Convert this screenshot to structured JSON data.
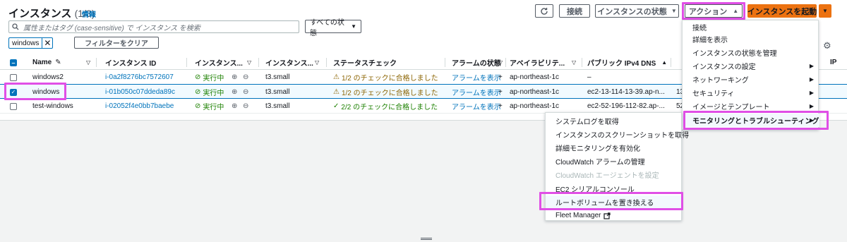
{
  "header": {
    "title": "インスタンス",
    "count": "(1/3)",
    "info": "情報"
  },
  "toolbar": {
    "refresh_icon": "refresh-icon",
    "connect_label": "接続",
    "instance_state_label": "インスタンスの状態",
    "actions_label": "アクション",
    "launch_label": "インスタンスを起動"
  },
  "search": {
    "placeholder": "属性またはタグ (case-sensitive) で インスタンス を検索",
    "state_filter": "すべての状態"
  },
  "filter": {
    "token": "windows",
    "clear_label": "フィルターをクリア"
  },
  "table": {
    "headers": {
      "name": "Name",
      "instance_id": "インスタンス ID",
      "state": "インスタンス...",
      "type": "インスタンス...",
      "status_check": "ステータスチェック",
      "alarm": "アラームの状態",
      "az": "アベイラビリテ...",
      "public_dns": "パブリック IPv4 DNS",
      "ip_suffix": "IP"
    },
    "rows": [
      {
        "name": "windows2",
        "id": "i-0a2f8276bc7572607",
        "state": "実行中",
        "type": "t3.small",
        "check": "1/2 のチェックに合格しました",
        "alarm": "アラームを表示",
        "az": "ap-northeast-1c",
        "dns": "–",
        "ip": ""
      },
      {
        "name": "windows",
        "id": "i-01b050c07ddeda89c",
        "state": "実行中",
        "type": "t3.small",
        "check": "1/2 のチェックに合格しました",
        "alarm": "アラームを表示",
        "az": "ap-northeast-1c",
        "dns": "ec2-13-114-13-39.ap-n...",
        "ip": "13"
      },
      {
        "name": "test-windows",
        "id": "i-02052f4e0bb7baebe",
        "state": "実行中",
        "type": "t3.small",
        "check": "2/2 のチェックに合格しました",
        "alarm": "アラームを表示",
        "az": "ap-northeast-1c",
        "dns": "ec2-52-196-112-82.ap-...",
        "ip": "52"
      }
    ]
  },
  "actions_menu": {
    "items": [
      {
        "label": "接続",
        "sub": false
      },
      {
        "label": "詳細を表示",
        "sub": false
      },
      {
        "label": "インスタンスの状態を管理",
        "sub": false
      },
      {
        "label": "インスタンスの設定",
        "sub": true
      },
      {
        "label": "ネットワーキング",
        "sub": true
      },
      {
        "label": "セキュリティ",
        "sub": true
      },
      {
        "label": "イメージとテンプレート",
        "sub": true
      },
      {
        "label": "モニタリングとトラブルシューティング",
        "sub": true
      }
    ]
  },
  "monitoring_submenu": {
    "items": [
      {
        "label": "システムログを取得"
      },
      {
        "label": "インスタンスのスクリーンショットを取得"
      },
      {
        "label": "詳細モニタリングを有効化"
      },
      {
        "label": "CloudWatch アラームの管理"
      },
      {
        "label": "CloudWatch エージェントを設定"
      },
      {
        "label": "EC2 シリアルコンソール"
      },
      {
        "label": "ルートボリュームを置き換える"
      },
      {
        "label": "Fleet Manager"
      }
    ]
  },
  "colors": {
    "accent": "#0073bb",
    "orange": "#ec7211",
    "highlight": "#e04fe6",
    "ok": "#1d8102"
  }
}
